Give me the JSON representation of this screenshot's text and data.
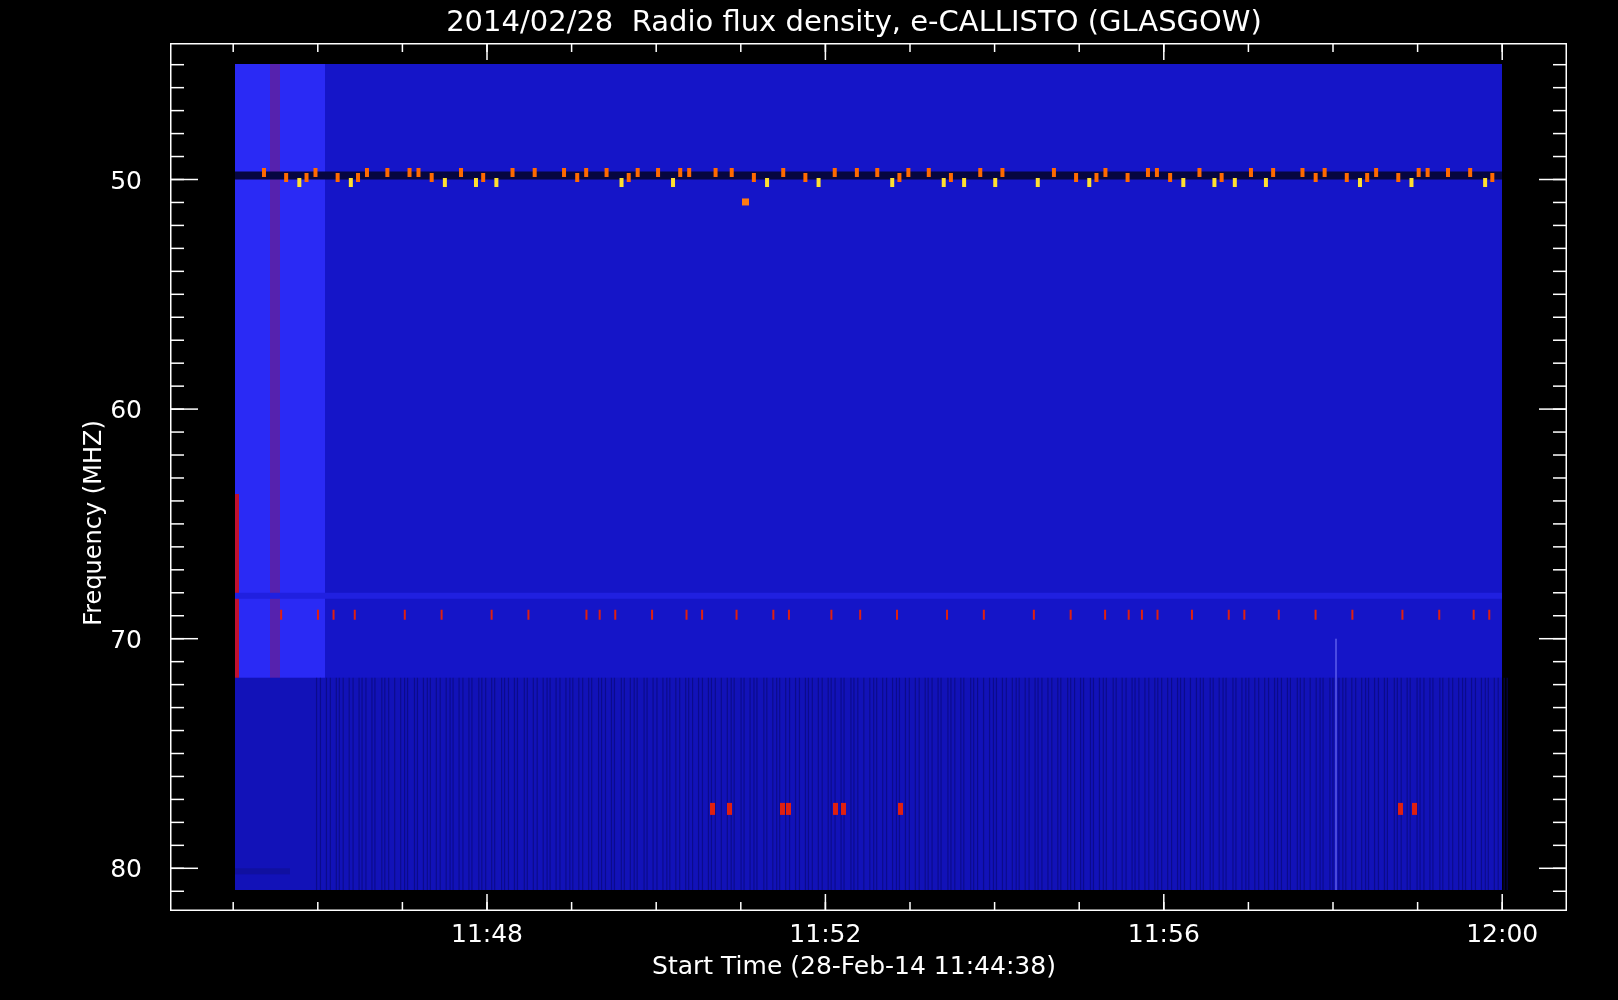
{
  "plot": {
    "title": "2014/02/28  Radio flux density, e-CALLISTO (GLASGOW)",
    "ylabel": "Frequency (MHZ)",
    "xlabel": "Start Time (28-Feb-14 11:44:38)",
    "y_ticks": [
      "50",
      "60",
      "70",
      "80"
    ],
    "x_ticks": [
      "11:48",
      "11:52",
      "11:56",
      "12:00"
    ]
  }
}
